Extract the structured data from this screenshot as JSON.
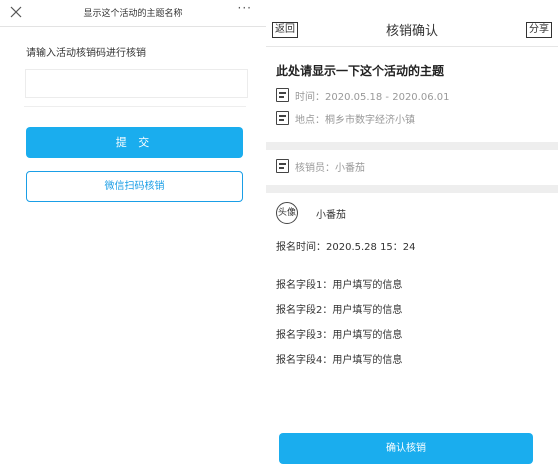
{
  "left": {
    "header": {
      "title": "显示这个活动的主题名称",
      "more": "···"
    },
    "prompt": "请输入活动核销码进行核销",
    "input": {
      "value": "",
      "placeholder": ""
    },
    "submit_label": "提 交",
    "scan_label": "微信扫码核销"
  },
  "right": {
    "header": {
      "back_label": "返回",
      "title": "核销确认",
      "share_label": "分享"
    },
    "event": {
      "title": "此处请显示一下这个活动的主题",
      "time": "时间：2020.05.18 - 2020.06.01",
      "location": "地点：桐乡市数字经济小镇"
    },
    "verifier": "核销员：小番茄",
    "participant": {
      "avatar_label": "头像",
      "name": "小番茄",
      "signup_time": "报名时间：2020.5.28 15：24",
      "fields": [
        "报名字段1：用户填写的信息",
        "报名字段2：用户填写的信息",
        "报名字段3：用户填写的信息",
        "报名字段4：用户填写的信息"
      ]
    },
    "confirm_label": "确认核销"
  },
  "colors": {
    "primary": "#1aadee",
    "outline_button": "#1a9ee6",
    "muted_text": "#999999",
    "band": "#eeeeee"
  },
  "icons": {
    "close": "close-icon",
    "more": "more-icon",
    "info": "info-card-icon"
  }
}
